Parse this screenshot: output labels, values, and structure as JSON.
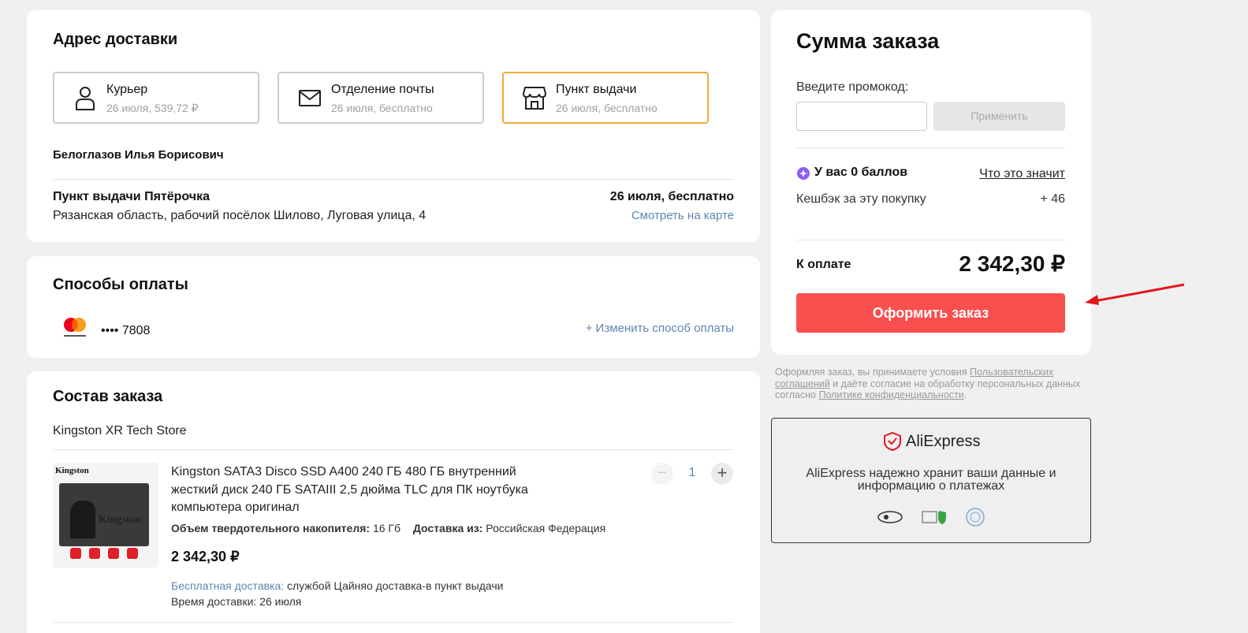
{
  "delivery": {
    "title": "Адрес доставки",
    "options": [
      {
        "title": "Курьер",
        "sub": "26 июля, 539,72 ₽",
        "icon": "person-icon"
      },
      {
        "title": "Отделение почты",
        "sub": "26 июля, бесплатно",
        "icon": "envelope-icon"
      },
      {
        "title": "Пункт выдачи",
        "sub": "26 июля, бесплатно",
        "icon": "store-icon"
      }
    ],
    "recipient": "Белоглазов Илья Борисович",
    "point_name": "Пункт выдачи Пятёрочка",
    "point_address": "Рязанская область, рабочий посёлок Шилово, Луговая улица, 4",
    "point_date": "26 июля, бесплатно",
    "map_link": "Смотреть на карте"
  },
  "payment": {
    "title": "Способы оплаты",
    "card_brand": "mastercard",
    "card_mask": "•••• 7808",
    "change_link": "+ Изменить способ оплаты"
  },
  "order": {
    "title": "Состав заказа",
    "store": "Kingston XR Tech Store",
    "item": {
      "title_line1": "Kingston SATA3 Disco SSD A400 240 ГБ 480 ГБ внутренний",
      "title_line2": "жесткий диск 240 ГБ SATAIII 2,5 дюйма TLC для ПК ноутбука",
      "title_line3": "компьютера оригинал",
      "spec_label": "Объем твердотельного накопителя:",
      "spec_value": "16 Гб",
      "ship_label": "Доставка из:",
      "ship_value": "Российская Федерация",
      "price": "2 342,30 ₽",
      "quantity": "1",
      "free_delivery": "Бесплатная доставка:",
      "delivery_service": "службой Цайняо доставка-в пункт выдачи",
      "delivery_time": "Время доставки: 26 июля",
      "image_brand": "Kingston"
    }
  },
  "summary": {
    "title": "Сумма заказа",
    "promo_label": "Введите промокод:",
    "promo_placeholder": "",
    "apply_label": "Применить",
    "points_text": "У вас 0 баллов",
    "points_link": "Что это значит",
    "cashback_label": "Кешбэк за эту покупку",
    "cashback_value": "+ 46",
    "total_label": "К оплате",
    "total_value": "2 342,30 ₽",
    "order_button": "Оформить заказ"
  },
  "legal": {
    "p1": "Оформляя заказ, вы принимаете условия ",
    "link1": "Пользовательских соглашений",
    "p2": " и даёте согласие на обработку персональных данных согласно ",
    "link2": "Политике конфиденциальности",
    "p3": "."
  },
  "trust": {
    "brand": "AliExpress",
    "text_line1": "AliExpress надежно хранит ваши данные и",
    "text_line2": "информацию о платежах"
  },
  "colors": {
    "accent_red": "#f94f4f",
    "selected_border": "#f2a93b",
    "link_blue": "#5b87b2",
    "points_purple": "#8b5cf6"
  }
}
